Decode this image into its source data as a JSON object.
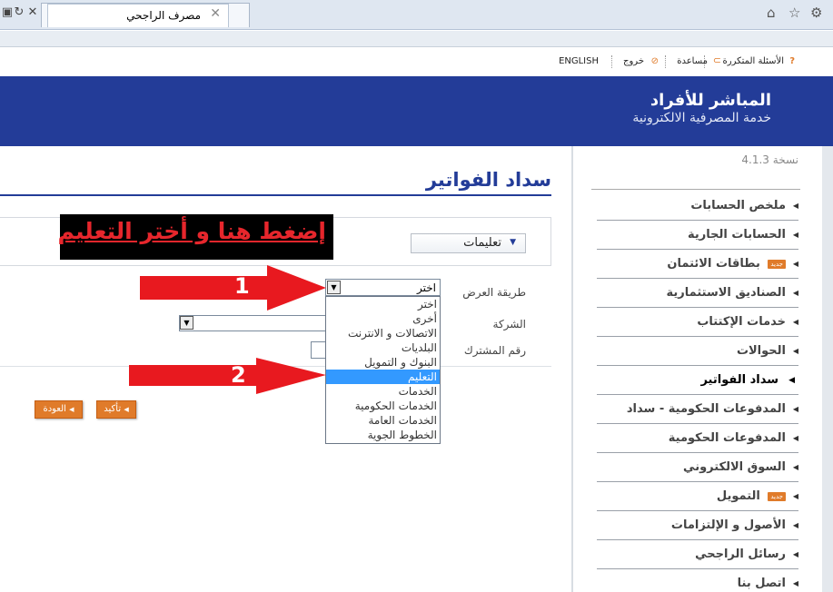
{
  "browser": {
    "tab_title": "مصرف الراجحي",
    "tab_close": "✕",
    "stop": "✕",
    "refresh": "↻"
  },
  "top_links": {
    "faq": "الأسئلة المتكررة",
    "help": "مساعدة",
    "logout": "خروج",
    "english": "ENGLISH"
  },
  "banner": {
    "title": "المباشر للأفراد",
    "subtitle": "خدمة المصرفية الالكترونية"
  },
  "sidebar": {
    "version": "نسخة 4.1.3",
    "badge_text": "جديد",
    "items": [
      {
        "label": "ملخص الحسابات"
      },
      {
        "label": "الحسابات الجارية"
      },
      {
        "label": "بطاقات الائتمان"
      },
      {
        "label": "الصناديق الاستثمارية"
      },
      {
        "label": "خدمات الإكتتاب"
      },
      {
        "label": "الحوالات"
      },
      {
        "label": "سداد الفواتير"
      },
      {
        "label": "المدفوعات الحكومية - سداد"
      },
      {
        "label": "المدفوعات الحكومية"
      },
      {
        "label": "السوق الالكتروني"
      },
      {
        "label": "التمويل"
      },
      {
        "label": "الأصول و الإلتزامات"
      },
      {
        "label": "رسائل الراجحي"
      },
      {
        "label": "اتصل بنا"
      }
    ]
  },
  "main": {
    "title": "سداد الفواتير",
    "instructions_label": "تعليمات",
    "annotation": "إضغط هنا و أختر التعليم",
    "form": {
      "display_method_label": "طريقة العرض",
      "company_label": "الشركة",
      "subscriber_label": "رقم المشترك",
      "selected_value": "اختر",
      "options": [
        "اختر",
        "أخرى",
        "الاتصالات و الانترنت",
        "البلديات",
        "البنوك و التمويل",
        "التعليم",
        "الخدمات",
        "الخدمات الحكومية",
        "الخدمات العامة",
        "الخطوط الجوية"
      ],
      "highlighted_option": "التعليم"
    },
    "confirm_button": "تأكيد",
    "back_button": "العودة"
  },
  "annotations": {
    "arrow1_number": "1",
    "arrow2_number": "2",
    "arrow_color": "#e8191f"
  },
  "colors": {
    "brand_blue": "#233c98",
    "orange": "#e07b2a",
    "highlight": "#3399ff"
  }
}
